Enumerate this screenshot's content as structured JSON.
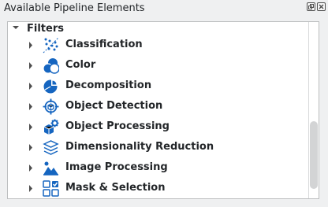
{
  "window": {
    "title": "Available Pipeline Elements",
    "buttons": {
      "float": "float-icon",
      "close": "close-icon"
    }
  },
  "tree": {
    "root": {
      "label": "Filters",
      "expanded": true
    },
    "items": [
      {
        "label": "Classification",
        "icon": "classification-icon"
      },
      {
        "label": "Color",
        "icon": "color-icon"
      },
      {
        "label": "Decomposition",
        "icon": "decomposition-icon"
      },
      {
        "label": "Object Detection",
        "icon": "object-detection-icon"
      },
      {
        "label": "Object Processing",
        "icon": "object-processing-icon"
      },
      {
        "label": "Dimensionality Reduction",
        "icon": "dimensionality-reduction-icon"
      },
      {
        "label": "Image Processing",
        "icon": "image-processing-icon"
      },
      {
        "label": "Mask & Selection",
        "icon": "mask-selection-icon"
      }
    ]
  },
  "colors": {
    "icon": "#1565c0",
    "accent": "#2a6fd1",
    "text": "#232629"
  }
}
